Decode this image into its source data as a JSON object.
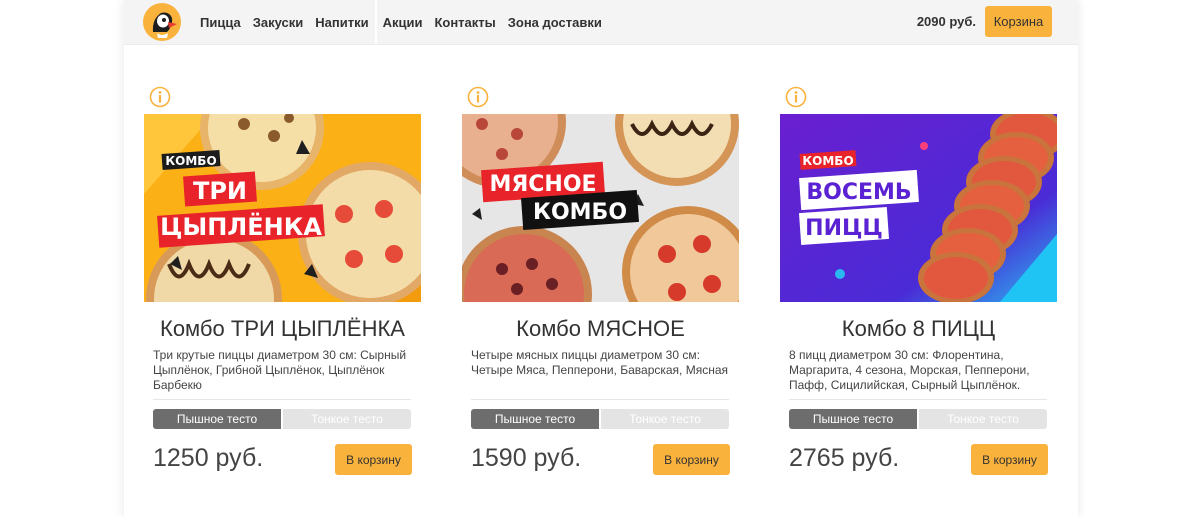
{
  "header": {
    "nav": [
      "Пицца",
      "Закуски",
      "Напитки",
      "Акции",
      "Контакты",
      "Зона доставки"
    ],
    "cart_sum": "2090 руб.",
    "cart_label": "Корзина",
    "logo_icon": "puffin-logo-icon"
  },
  "colors": {
    "accent": "#f9b23c",
    "header_bg": "#f4f4f4",
    "dough_active": "#6d6d6d",
    "dough_inactive": "#e4e4e4"
  },
  "cards": [
    {
      "title": "Комбо ТРИ ЦЫПЛЁНКА",
      "desc": "Три крутые пиццы диаметром 30 см: Сырный Цыплёнок, Грибной Цыплёнок, Цыплёнок Барбекю",
      "dough_thick": "Пышное тесто",
      "dough_thin": "Тонкое тесто",
      "price": "1250 руб.",
      "add_label": "В корзину",
      "promo_small": "КОМБО",
      "promo_lines": [
        "ТРИ",
        "ЦЫПЛЁНКА"
      ]
    },
    {
      "title": "Комбо МЯСНОЕ",
      "desc": "Четыре мясных пиццы диаметром 30 см: Четыре Мяса, Пепперони, Баварская, Мясная",
      "dough_thick": "Пышное тесто",
      "dough_thin": "Тонкое тесто",
      "price": "1590 руб.",
      "add_label": "В корзину",
      "promo_lines": [
        "МЯСНОЕ",
        "КОМБО"
      ]
    },
    {
      "title": "Комбо 8 ПИЦЦ",
      "desc": "8 пицц диаметром 30 см: Флорентина, Маргарита, 4 сезона, Морская, Пепперони, Пафф, Сицилийская, Сырный Цыплёнок.",
      "dough_thick": "Пышное тесто",
      "dough_thin": "Тонкое тесто",
      "price": "2765 руб.",
      "add_label": "В корзину",
      "promo_small": "КОМБО",
      "promo_lines": [
        "ВОСЕМЬ",
        "ПИЦЦ"
      ]
    }
  ]
}
